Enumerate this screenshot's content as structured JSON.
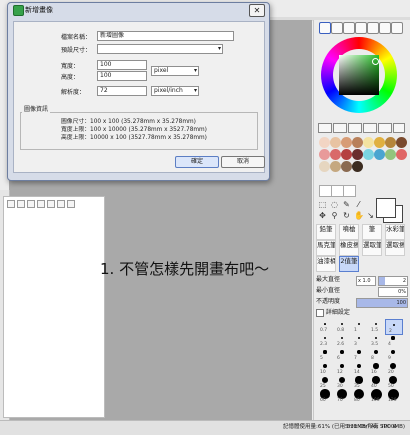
{
  "dialog": {
    "title": "新增畫像",
    "close_label": "✕",
    "fields": {
      "name_label": "檔案名稱：",
      "name_value": "新增圖像",
      "preset_label": "預設尺寸：",
      "preset_value": "",
      "width_label": "寬度：",
      "width_value": "100",
      "height_label": "高度：",
      "height_value": "100",
      "unit_value": "pixel",
      "resolution_label": "解析度：",
      "resolution_value": "72",
      "resolution_unit": "pixel/inch"
    },
    "info": {
      "title": "圖像資訊",
      "rows": [
        {
          "label": "圖像尺寸：",
          "value": "100 x 100 (35.278mm x 35.278mm)"
        },
        {
          "label": "寬度上限：",
          "value": "100 x 10000 (35.278mm x 3527.78mm)"
        },
        {
          "label": "高度上限：",
          "value": "10000 x 100 (3527.78mm x 35.278mm)"
        }
      ]
    },
    "ok_label": "確定",
    "cancel_label": "取消"
  },
  "canvas": {
    "caption": "1. 不管怎樣先開畫布吧～"
  },
  "palette": {
    "swatch_colors": [
      "#f2d5c4",
      "#e8c3a2",
      "#d79c76",
      "#b8805a",
      "#f4e3a0",
      "#e0b040",
      "#b5853b",
      "#7a4a2e",
      "#e89a9a",
      "#d96a6a",
      "#b54040",
      "#6a2d2d",
      "#7ad3e0",
      "#4aa5d0",
      "#93c47d",
      "#e06666",
      "#e6d6c0",
      "#c5a880",
      "#8a6a50",
      "#3c2c20"
    ],
    "brush_tools": [
      {
        "label": "鉛筆"
      },
      {
        "label": "噴槍"
      },
      {
        "label": "筆"
      },
      {
        "label": "水彩筆"
      },
      {
        "label": "馬克筆"
      },
      {
        "label": "橡皮擦"
      },
      {
        "label": "選取筆"
      },
      {
        "label": "選取擦"
      },
      {
        "label": "油漆桶"
      },
      {
        "label": "2值筆"
      }
    ]
  },
  "props": {
    "max_size_label": "最大直徑",
    "max_size_mult": "x 1.0",
    "max_size_value": "2",
    "min_size_label": "最小直徑",
    "min_size_value": "0%",
    "density_label": "不透明度",
    "density_value": "100",
    "advanced_label": "詳細設定"
  },
  "brush_sizes": [
    "0.7",
    "0.8",
    "1",
    "1.5",
    "2",
    "2.3",
    "2.6",
    "3",
    "3.5",
    "4",
    "5",
    "6",
    "7",
    "8",
    "9",
    "10",
    "12",
    "14",
    "16",
    "20",
    "25",
    "30",
    "35",
    "40",
    "50",
    "60",
    "70",
    "80",
    "100",
    "120"
  ],
  "status": {
    "text": "記憶體使用量:61% (已用 531MB/所有 7000MB)",
    "keys": "Shift Ctrl Alt SPC ⊕"
  }
}
